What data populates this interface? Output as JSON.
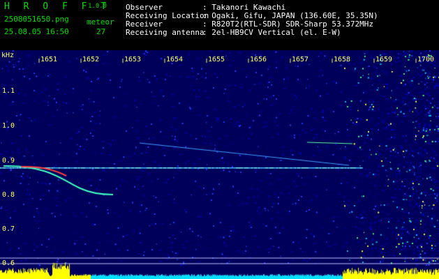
{
  "app": {
    "name": "H R O F F T",
    "version": "1.0.0"
  },
  "file": {
    "name": "2508051650.png",
    "datetime": "25.08.05 16:50"
  },
  "meteor": {
    "label": "meteor",
    "count": "27"
  },
  "info": [
    {
      "label": "Observer",
      "value": ": Takanori Kawachi"
    },
    {
      "label": "Receiving Location",
      "value": ": Ogaki, Gifu, JAPAN (136.60E, 35.35N)"
    },
    {
      "label": "Receiver",
      "value": ": R820T2(RTL-SDR) SDR-Sharp 53.372MHz"
    },
    {
      "label": "Receiving antenna",
      "value": ": 2el-HB9CV Vertical (el. E-W)"
    }
  ],
  "axes": {
    "y_unit": "kHz",
    "x_ticks": [
      "1651",
      "1652",
      "1653",
      "1654",
      "1655",
      "1656",
      "1657",
      "1658",
      "1659",
      "1700"
    ],
    "y_ticks": [
      "1.1",
      "1.0",
      "0.9",
      "0.8",
      "0.7",
      "0.6"
    ]
  },
  "colors": {
    "header_green": "#00e000",
    "tick_yellow": "#ffff60",
    "background_blue": "#00005a"
  }
}
